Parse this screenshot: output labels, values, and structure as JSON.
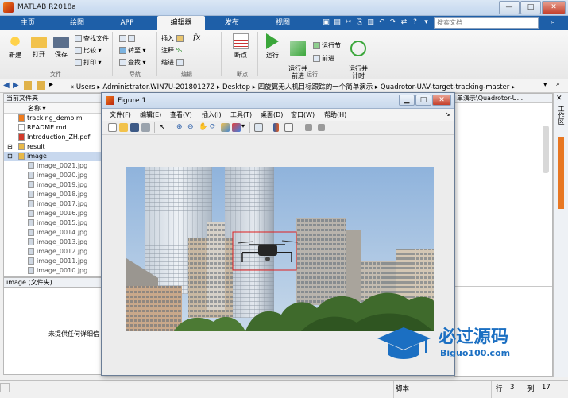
{
  "window": {
    "title": "MATLAB R2018a",
    "controls": [
      "—",
      "□",
      "✕"
    ]
  },
  "ribbon_tabs": [
    {
      "label": "主页",
      "active": false
    },
    {
      "label": "绘图",
      "active": false
    },
    {
      "label": "APP",
      "active": false
    },
    {
      "label": "编辑器",
      "active": true
    },
    {
      "label": "发布",
      "active": false
    },
    {
      "label": "视图",
      "active": false
    }
  ],
  "search": {
    "placeholder": "搜索文档"
  },
  "ribbon": {
    "file": {
      "new": "新建",
      "open": "打开",
      "save": "保存",
      "find_files": "查找文件",
      "compare": "比较",
      "print": "打印",
      "group": "文件"
    },
    "nav": {
      "goto": "转至",
      "find": "查找",
      "group": "导航"
    },
    "edit": {
      "insert": "插入",
      "fx": "fx",
      "comment": "注释",
      "percent": "%",
      "indent": "缩进",
      "group": "编辑"
    },
    "breakpoints": {
      "label": "断点",
      "group": "断点"
    },
    "run": {
      "run": "运行",
      "run_advance": "运行并\n前进",
      "run_section": "运行节",
      "advance": "前进",
      "run_time": "运行并\n计时",
      "group": "运行"
    }
  },
  "address": {
    "crumbs": [
      "«",
      "Users",
      "Administrator.WIN7U-20180127Z",
      "Desktop",
      "四旋翼无人机目标跟踪的一个简单演示",
      "Quadrotor-UAV-target-tracking-master"
    ]
  },
  "folder_panel": {
    "title": "当前文件夹",
    "column": "名称 ▾",
    "items": [
      {
        "name": "tracking_demo.m",
        "type": "m"
      },
      {
        "name": "README.md",
        "type": "md"
      },
      {
        "name": "Introduction_ZH.pdf",
        "type": "pdf"
      },
      {
        "name": "result",
        "type": "folder"
      },
      {
        "name": "image",
        "type": "folder-open"
      },
      {
        "name": "image_0021.jpg",
        "type": "jpg"
      },
      {
        "name": "image_0020.jpg",
        "type": "jpg"
      },
      {
        "name": "image_0019.jpg",
        "type": "jpg"
      },
      {
        "name": "image_0018.jpg",
        "type": "jpg"
      },
      {
        "name": "image_0017.jpg",
        "type": "jpg"
      },
      {
        "name": "image_0016.jpg",
        "type": "jpg"
      },
      {
        "name": "image_0015.jpg",
        "type": "jpg"
      },
      {
        "name": "image_0014.jpg",
        "type": "jpg"
      },
      {
        "name": "image_0013.jpg",
        "type": "jpg"
      },
      {
        "name": "image_0012.jpg",
        "type": "jpg"
      },
      {
        "name": "image_0011.jpg",
        "type": "jpg"
      },
      {
        "name": "image_0010.jpg",
        "type": "jpg"
      }
    ]
  },
  "details": {
    "header": "image  (文件夹)",
    "message": "未提供任何详细信"
  },
  "right_panel": {
    "path_text": "单演示\\Quadrotor-U...",
    "side_label": "工作区"
  },
  "figure": {
    "title": "Figure 1",
    "menu": [
      "文件(F)",
      "编辑(E)",
      "查看(V)",
      "插入(I)",
      "工具(T)",
      "桌面(D)",
      "窗口(W)",
      "帮助(H)"
    ]
  },
  "status": {
    "mode": "脚本",
    "row_label": "行",
    "row": "3",
    "col_label": "列",
    "col": "17"
  },
  "watermark": {
    "text": "必过源码",
    "url": "Biguo100.com"
  },
  "colors": {
    "tab_blue": "#1e5fa8",
    "accent_orange": "#e87722",
    "tracking_box": "#e02020",
    "watermark_blue": "#1b6fc2"
  }
}
